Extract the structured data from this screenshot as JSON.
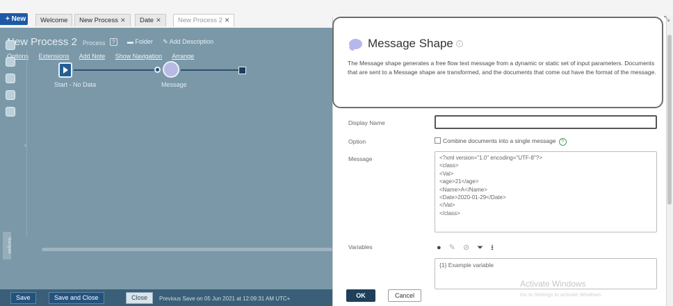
{
  "tabs": {
    "new_label": "+ New",
    "items": [
      {
        "label": "Welcome",
        "closable": false
      },
      {
        "label": "New Process",
        "closable": true
      },
      {
        "label": "Date",
        "closable": true
      },
      {
        "label": "New Process 2",
        "closable": true
      }
    ],
    "close_glyph": "✕"
  },
  "process": {
    "title": "New Process 2",
    "subtitle": "Process",
    "help": "?",
    "folder_link": "Folder",
    "add_description_link": "Add Description",
    "menu": [
      "Options",
      "Extensions",
      "Add Note",
      "Show Navigation",
      "Arrange"
    ],
    "shapes": {
      "start_label": "Start - No Data",
      "message_label": "Message"
    },
    "rail_icons": [
      "search-icon",
      "connector-icon",
      "logic-icon",
      "shape-icon",
      "database-icon"
    ],
    "zoom_label": "Navigate",
    "collapse_arrow": "‹"
  },
  "bottom_bar": {
    "save": "Save",
    "save_and_close": "Save and Close",
    "close": "Close",
    "last_saved": "Previous Save on 05 Jun 2021 at 12:09:31 AM UTC+"
  },
  "panel": {
    "title": "Message Shape",
    "info": "i",
    "description": "The Message shape generates a free flow text message from a dynamic or static set of input parameters. Documents that are sent to a Message shape are transformed, and the documents that come out have the format of the message.",
    "display_name_label": "Display Name",
    "display_name_value": "",
    "option_label": "Option",
    "option_checkbox_label": "Combine documents into a single message",
    "option_help": "?",
    "message_label": "Message",
    "message_lines": [
      "<?xml version=\"1.0\" encoding=\"UTF-8\"?>",
      "<class>",
      "<Val>",
      "<age>21</age>",
      "<Name>A</Name>",
      "<Date>2020-01-29</Date>",
      "</Val>",
      "</class>"
    ],
    "variables_label": "Variables",
    "variable_tools": [
      "add-icon",
      "edit-icon",
      "delete-icon",
      "filter-icon",
      "export-icon"
    ],
    "variables": [
      "{1} Example variable"
    ],
    "ok": "OK",
    "cancel": "Cancel"
  },
  "watermark": {
    "title": "Activate Windows",
    "subtitle": "Go to Settings to activate Windows."
  },
  "colors": {
    "accent": "#1d5aa6",
    "canvas": "#7a98a8",
    "bottom_bar": "#3b5f79",
    "ok_button": "#1f3f5b"
  }
}
